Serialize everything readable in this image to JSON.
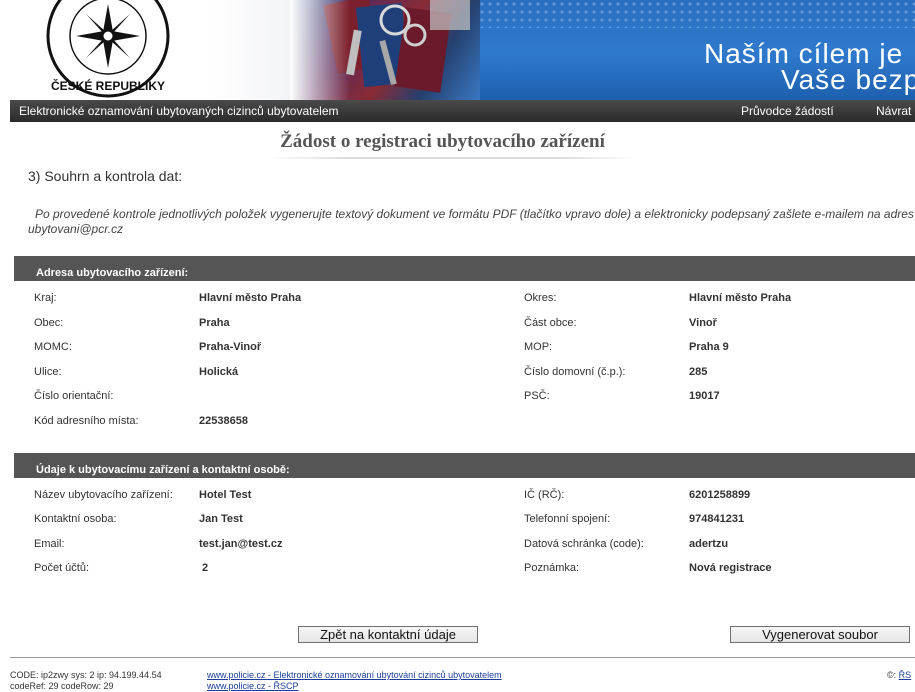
{
  "banner": {
    "emblem_text": "ČESKÉ REPUBLIKY",
    "slogan_line1": "Naším cílem je",
    "slogan_line2": "Vaše bezp"
  },
  "navbar": {
    "site_title": "Elektronické oznamování ubytovaných cizinců ubytovatelem",
    "guide_link": "Průvodce žádostí",
    "back_link": "Návrat n"
  },
  "page": {
    "title": "Žádost o registraci ubytovacího zařízení",
    "step": "3) Souhrn a kontrola dat:",
    "instructions_line1": "Po provedené kontrole jednotlivých položek vygenerujte textový dokument ve formátu PDF (tlačítko vpravo dole) a elektronicky podepsaný zašlete e-mailem na adres",
    "instructions_line2": "ubytovani@pcr.cz"
  },
  "address_section": {
    "heading": "Adresa ubytovacího zařízení:",
    "left": [
      {
        "label": "Kraj:",
        "value": "Hlavní město Praha"
      },
      {
        "label": "Obec:",
        "value": "Praha"
      },
      {
        "label": "MOMC:",
        "value": "Praha-Vinoř"
      },
      {
        "label": "Ulice:",
        "value": "Holická"
      },
      {
        "label": "Číslo orientační:",
        "value": ""
      },
      {
        "label": "Kód adresního místa:",
        "value": "22538658"
      }
    ],
    "right": [
      {
        "label": "Okres:",
        "value": "Hlavní město Praha"
      },
      {
        "label": "Část obce:",
        "value": "Vinoř"
      },
      {
        "label": "MOP:",
        "value": "Praha 9"
      },
      {
        "label": "Číslo domovní (č.p.):",
        "value": "285"
      },
      {
        "label": "PSČ:",
        "value": "19017"
      }
    ]
  },
  "contact_section": {
    "heading": "Údaje k ubytovacímu zařízení a kontaktní osobě:",
    "left": [
      {
        "label": "Název ubytovacího zařízení:",
        "value": "Hotel Test"
      },
      {
        "label": "Kontaktní osoba:",
        "value": "Jan Test"
      },
      {
        "label": "Email:",
        "value": "test.jan@test.cz"
      },
      {
        "label": "Počet účtů:",
        "value": "2"
      }
    ],
    "right": [
      {
        "label": "IČ (RČ):",
        "value": "6201258899"
      },
      {
        "label": "Telefonní spojení:",
        "value": "974841231"
      },
      {
        "label": "Datová schránka (code):",
        "value": "adertzu"
      },
      {
        "label": "Poznámka:",
        "value": "Nová registrace"
      }
    ]
  },
  "buttons": {
    "back": "Zpět na kontaktní údaje",
    "generate": "Vygenerovat soubor"
  },
  "footer": {
    "code_line1": "CODE: ip2zwy sys: 2 ip: 94.199.44.54",
    "code_line2": "codeRef: 29 codeRow: 29",
    "link1": "www.policie.cz - Elektronické oznamování ubytování cizinců ubytovatelem",
    "link2": "www.policie.cz - ŘSCP",
    "copyright_prefix": "©:",
    "copyright_link": "ŘS"
  }
}
